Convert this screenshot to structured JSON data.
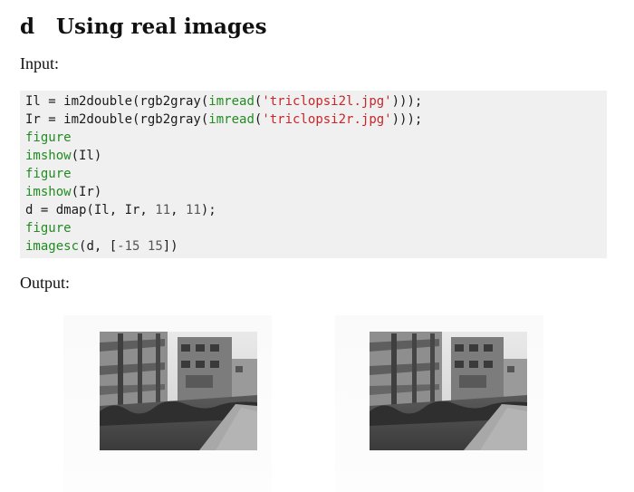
{
  "section": {
    "number": "d",
    "title": "Using real images"
  },
  "input_label": "Input:",
  "output_label": "Output:",
  "code_lines": [
    [
      {
        "t": "Il = im2double(rgb2gray(",
        "c": ""
      },
      {
        "t": "imread",
        "c": "kw"
      },
      {
        "t": "(",
        "c": ""
      },
      {
        "t": "'triclopsi2l.jpg'",
        "c": "str"
      },
      {
        "t": ")));",
        "c": ""
      }
    ],
    [
      {
        "t": "Ir = im2double(rgb2gray(",
        "c": ""
      },
      {
        "t": "imread",
        "c": "kw"
      },
      {
        "t": "(",
        "c": ""
      },
      {
        "t": "'triclopsi2r.jpg'",
        "c": "str"
      },
      {
        "t": ")));",
        "c": ""
      }
    ],
    [
      {
        "t": "figure",
        "c": "kw"
      }
    ],
    [
      {
        "t": "imshow",
        "c": "kw"
      },
      {
        "t": "(Il)",
        "c": ""
      }
    ],
    [
      {
        "t": "figure",
        "c": "kw"
      }
    ],
    [
      {
        "t": "imshow",
        "c": "kw"
      },
      {
        "t": "(Ir)",
        "c": ""
      }
    ],
    [
      {
        "t": "d = dmap(Il, Ir, ",
        "c": ""
      },
      {
        "t": "11",
        "c": "numlit"
      },
      {
        "t": ", ",
        "c": ""
      },
      {
        "t": "11",
        "c": "numlit"
      },
      {
        "t": ");",
        "c": ""
      }
    ],
    [
      {
        "t": "figure",
        "c": "kw"
      }
    ],
    [
      {
        "t": "imagesc",
        "c": "kw"
      },
      {
        "t": "(d, [",
        "c": ""
      },
      {
        "t": "-15 15",
        "c": "numlit"
      },
      {
        "t": "])",
        "c": ""
      }
    ]
  ],
  "output_images": [
    {
      "name": "left-image",
      "depicts": "triclopsi2l"
    },
    {
      "name": "right-image",
      "depicts": "triclopsi2r"
    }
  ]
}
